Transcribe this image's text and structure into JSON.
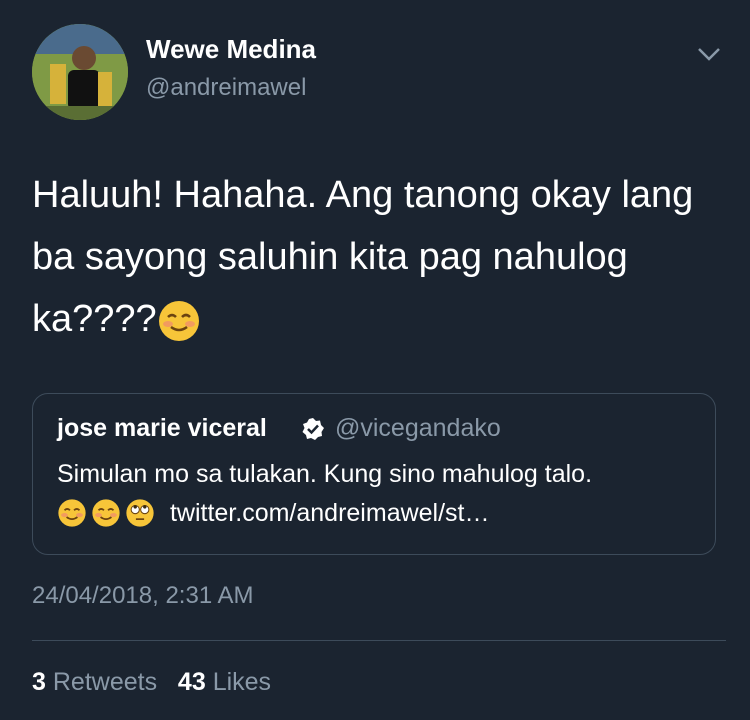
{
  "author": {
    "name": "Wewe Medina",
    "handle": "@andreimawel"
  },
  "tweet": {
    "text_line1": "Haluuh! Hahaha. Ang tanong okay lang",
    "text_line2": "ba sayong saluhin kita pag nahulog",
    "text_line3": "ka????",
    "line3_emoji": "smiling-blush-emoji"
  },
  "quoted": {
    "name": "jose marie viceral",
    "handle": "@vicegandako",
    "verified": true,
    "text": "Simulan mo sa tulakan. Kung sino mahulog talo.",
    "emojis": [
      "smiling-blush-emoji",
      "smiling-blush-emoji",
      "eye-roll-emoji"
    ],
    "link": "twitter.com/andreimawel/st…"
  },
  "timestamp": "24/04/2018, 2:31 AM",
  "stats": {
    "retweets_count": "3",
    "retweets_label": "Retweets",
    "likes_count": "43",
    "likes_label": "Likes"
  },
  "colors": {
    "background": "#1b2430",
    "secondary_text": "#8a99a8",
    "border": "#3d4b5a"
  }
}
